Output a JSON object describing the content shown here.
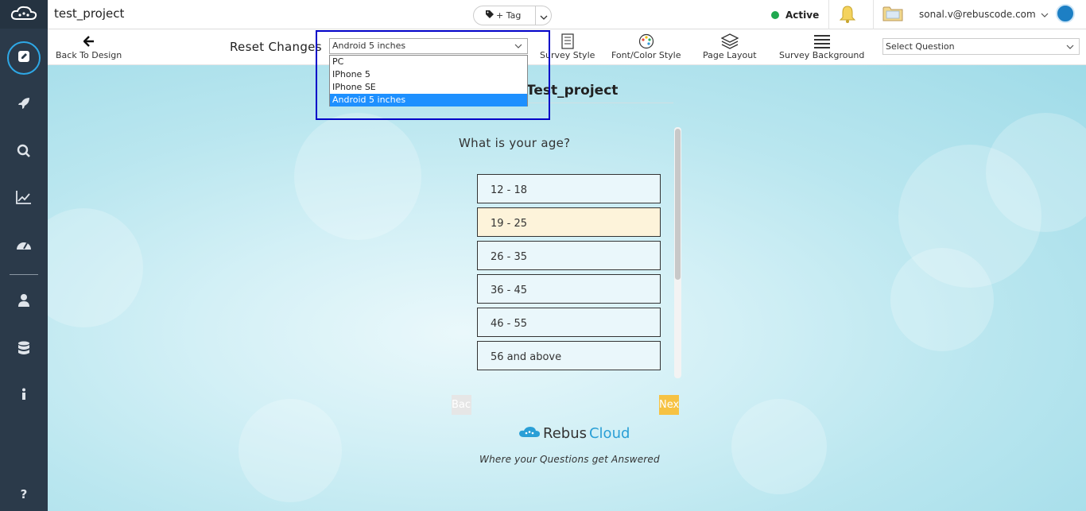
{
  "header": {
    "project_title": "test_project",
    "tag_button_label": "+ Tag",
    "status_label": "Active",
    "status_color": "#1fa84f",
    "user_email": "sonal.v@rebuscode.com"
  },
  "toolbar": {
    "back_label": "Back To Design",
    "reset_label": "Reset Changes",
    "device_select_value": "Android 5 inches",
    "device_options": [
      "PC",
      "IPhone 5",
      "IPhone SE",
      "Android 5 inches"
    ],
    "selected_device_index": 3,
    "survey_style_label": "Survey Style",
    "font_color_label": "Font/Color Style",
    "page_layout_label": "Page Layout",
    "survey_background_label": "Survey Background",
    "question_select_value": "Select Question"
  },
  "sidebar": {
    "items": [
      "edit-icon",
      "rocket-icon",
      "search-icon",
      "chart-line-icon",
      "dashboard-icon",
      "user-icon",
      "database-icon",
      "info-icon",
      "help-icon"
    ],
    "accent_color": "#2ea8e6"
  },
  "survey": {
    "title": "Test_project",
    "question": "What is your age?",
    "options": [
      "12 - 18",
      "19 - 25",
      "26 - 35",
      "36 - 45",
      "46 - 55",
      "56 and above"
    ],
    "selected_index": 1,
    "back_label": "Back",
    "next_label": "Next",
    "brand_part1": "Rebus",
    "brand_part2": "Cloud",
    "tagline": "Where your Questions get Answered"
  }
}
